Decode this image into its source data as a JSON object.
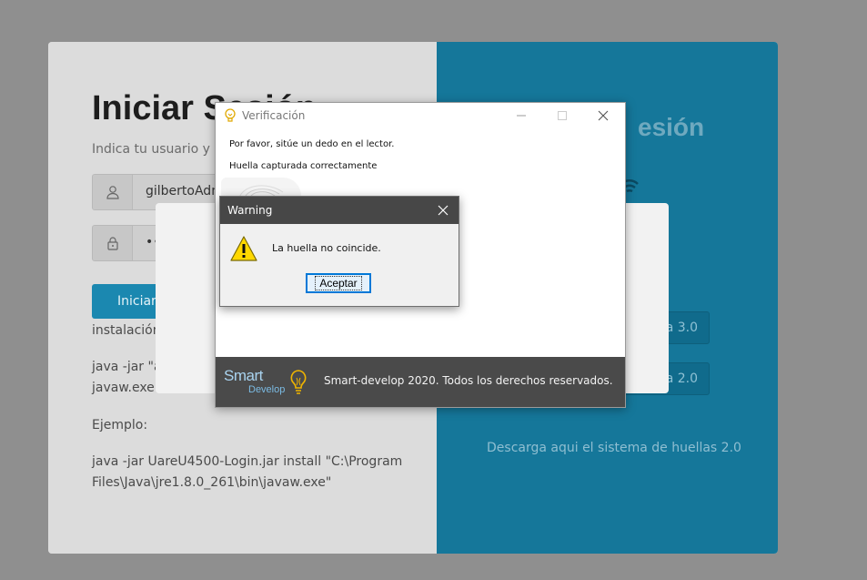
{
  "login": {
    "title": "Iniciar Sesión",
    "subtitle": "Indica tu usuario y c",
    "username_value": "gilbertoAdm",
    "password_mask": "••",
    "login_button": "Iniciar",
    "instructions": {
      "line_install": "instalación",
      "line_java_1": "java -jar \"a",
      "line_java_2": "javaw.exe\"",
      "example_label": "Ejemplo:",
      "example_line_1": "java -jar UareU4500-Login.jar install \"C:\\Program",
      "example_line_2": "Files\\Java\\jre1.8.0_261\\bin\\javaw.exe\""
    },
    "right_panel": {
      "title_partial": "esión",
      "download_btn_30": "a 3.0",
      "download_btn_20": "a 2.0",
      "download_link": "Descarga aqui el sistema de huellas 2.0"
    },
    "colors": {
      "left_bg": "#dcdcdc",
      "right_bg": "#15779a",
      "login_btn": "#1b88b0"
    }
  },
  "verification_window": {
    "title": "Verificación",
    "message_1": "Por favor, sitúe un dedo en el lector.",
    "message_2": "Huella capturada correctamente",
    "brand_top": "Smart",
    "brand_bottom": "Develop",
    "footer": "Smart-develop 2020. Todos los derechos reservados.",
    "icons": {
      "app": "lightbulb-icon",
      "minimize": "minimize-icon",
      "maximize": "maximize-icon",
      "close": "close-icon"
    }
  },
  "warning_dialog": {
    "title": "Warning",
    "message": "La huella no coincide.",
    "ok_button": "Aceptar",
    "icon": "warning-icon"
  }
}
